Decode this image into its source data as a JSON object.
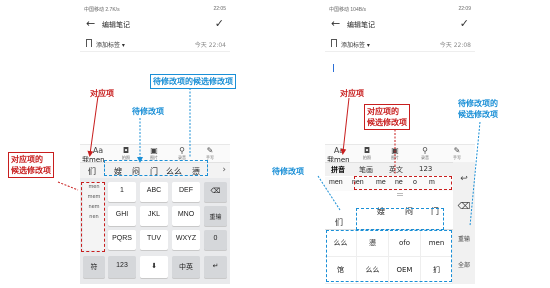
{
  "left": {
    "status_left": "中国移动 2.7K/s",
    "status_right": "22:05",
    "title": "编辑笔记",
    "tag": "添加标签 ▾",
    "date": "今天 22:04",
    "toolbar": [
      "Aa",
      "拍照",
      "图片",
      "录音",
      "手写"
    ],
    "composing": "我men",
    "candidates": [
      "们",
      "嫂",
      "闷",
      "门",
      "么么",
      "懑"
    ],
    "side_column": [
      "men",
      "mem",
      "nem",
      "nen"
    ],
    "keys": [
      [
        "1",
        "ABC",
        "DEF"
      ],
      [
        "GHI",
        "JKL",
        "MNO"
      ],
      [
        "PQRS",
        "TUV",
        "WXYZ"
      ]
    ],
    "key_subs": [
      "",
      "",
      "",
      "",
      "",
      "",
      "",
      "",
      ""
    ],
    "right_keys": [
      "⌫",
      "重输",
      "0"
    ],
    "bottom_keys": [
      "符",
      "123",
      "⬇",
      "中英",
      "↵"
    ]
  },
  "right": {
    "status_left": "中国移动 104B/s",
    "status_right": "22:09",
    "title": "编辑笔记",
    "tag": "添加标签 ▾",
    "date": "今天 22:08",
    "toolbar": [
      "Aa",
      "拍照",
      "图片",
      "录音",
      "手写"
    ],
    "composing": "我men",
    "modes": [
      "拼音",
      "笔画",
      "英文",
      "123"
    ],
    "pinyin": [
      "men",
      "nen",
      "me",
      "ne",
      "o",
      "m"
    ],
    "left_candidate": "们",
    "top_candidates": [
      "嫂",
      "闷",
      "门"
    ],
    "grid": [
      "么么",
      "懑",
      "ofo",
      "men",
      "馆",
      "么么",
      "OEM",
      "扪"
    ],
    "side": [
      "↩",
      "⌫",
      "重输",
      "全部"
    ]
  },
  "annotations": {
    "l_corresponding": "对应项",
    "l_to_modify_cand": "待修改项的候选修改项",
    "l_to_modify": "待修改项",
    "l_cand_line1": "对应项的",
    "l_cand_line2": "候选修改项",
    "r_corresponding": "对应项",
    "r_cand_line1": "对应项的",
    "r_cand_line2": "候选修改项",
    "r_to_modify_line1": "待修改项的",
    "r_to_modify_line2": "候选修改项",
    "r_to_modify": "待修改项"
  },
  "colors": {
    "red": "#c81e1e",
    "blue": "#1a8fd6"
  }
}
